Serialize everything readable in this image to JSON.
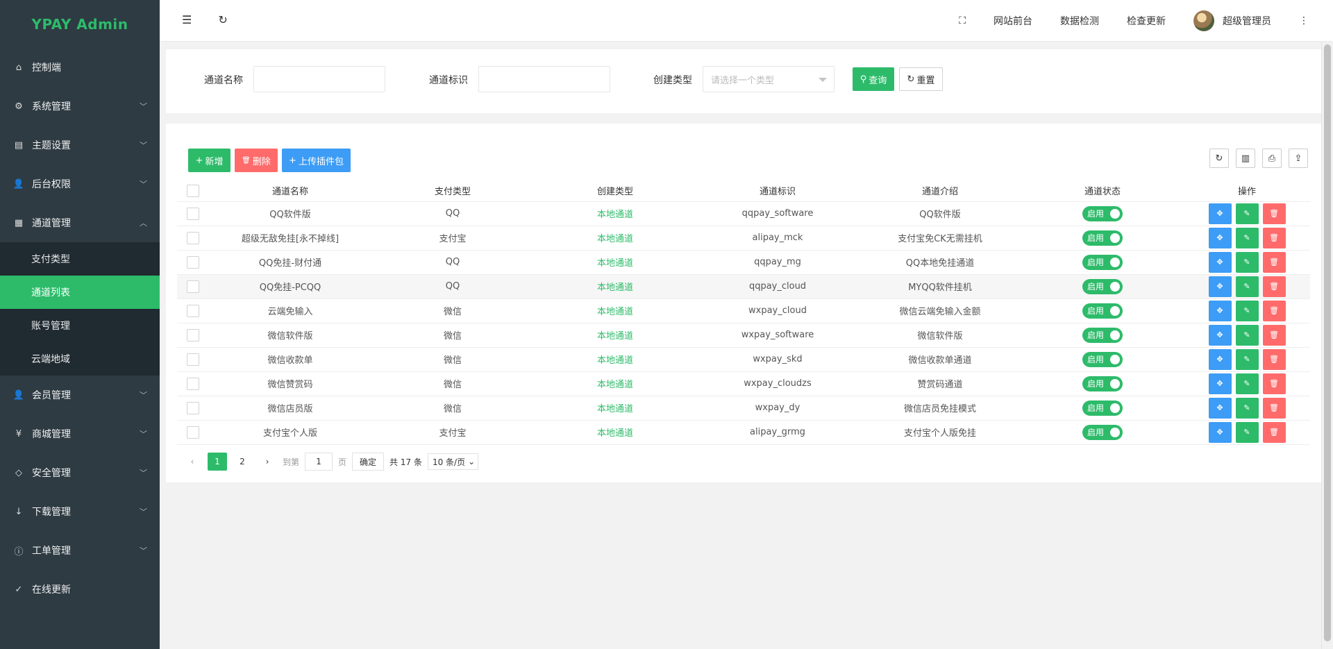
{
  "app": {
    "title": "YPAY Admin"
  },
  "sidebar": {
    "items": [
      {
        "label": "控制端",
        "icon": "home-icon",
        "glyph": "⌂"
      },
      {
        "label": "系统管理",
        "icon": "gear-icon",
        "glyph": "⚙"
      },
      {
        "label": "主题设置",
        "icon": "layout-icon",
        "glyph": "▤"
      },
      {
        "label": "后台权限",
        "icon": "user-icon",
        "glyph": "👤"
      },
      {
        "label": "通道管理",
        "icon": "apps-icon",
        "glyph": "▦"
      }
    ],
    "sub_items": [
      {
        "label": "支付类型"
      },
      {
        "label": "通道列表"
      },
      {
        "label": "账号管理"
      },
      {
        "label": "云端地域"
      }
    ],
    "items_after": [
      {
        "label": "会员管理",
        "icon": "member-icon",
        "glyph": "👤"
      },
      {
        "label": "商城管理",
        "icon": "yen-icon",
        "glyph": "¥"
      },
      {
        "label": "安全管理",
        "icon": "diamond-icon",
        "glyph": "◇"
      },
      {
        "label": "下载管理",
        "icon": "download-icon",
        "glyph": "↓"
      },
      {
        "label": "工单管理",
        "icon": "info-icon",
        "glyph": "ⓘ"
      },
      {
        "label": "在线更新",
        "icon": "shield-check-icon",
        "glyph": "✓"
      }
    ]
  },
  "topbar": {
    "links": [
      "网站前台",
      "数据检测",
      "检查更新"
    ],
    "user": "超级管理员"
  },
  "search": {
    "name_label": "通道名称",
    "code_label": "通道标识",
    "type_label": "创建类型",
    "type_placeholder": "请选择一个类型",
    "query_label": "查询",
    "reset_label": "重置"
  },
  "toolbar": {
    "add_label": "新增",
    "delete_label": "删除",
    "upload_label": "上传插件包"
  },
  "table": {
    "columns": [
      "通道名称",
      "支付类型",
      "创建类型",
      "通道标识",
      "通道介绍",
      "通道状态",
      "操作"
    ],
    "rows": [
      {
        "name": "QQ软件版",
        "pay": "QQ",
        "type": "本地通道",
        "code": "qqpay_software",
        "desc": "QQ软件版",
        "status": "启用"
      },
      {
        "name": "超级无敌免挂[永不掉线]",
        "pay": "支付宝",
        "type": "本地通道",
        "code": "alipay_mck",
        "desc": "支付宝免CK无需挂机",
        "status": "启用"
      },
      {
        "name": "QQ免挂-财付通",
        "pay": "QQ",
        "type": "本地通道",
        "code": "qqpay_mg",
        "desc": "QQ本地免挂通道",
        "status": "启用"
      },
      {
        "name": "QQ免挂-PCQQ",
        "pay": "QQ",
        "type": "本地通道",
        "code": "qqpay_cloud",
        "desc": "MYQQ软件挂机",
        "status": "启用"
      },
      {
        "name": "云端免输入",
        "pay": "微信",
        "type": "本地通道",
        "code": "wxpay_cloud",
        "desc": "微信云端免输入金额",
        "status": "启用"
      },
      {
        "name": "微信软件版",
        "pay": "微信",
        "type": "本地通道",
        "code": "wxpay_software",
        "desc": "微信软件版",
        "status": "启用"
      },
      {
        "name": "微信收款单",
        "pay": "微信",
        "type": "本地通道",
        "code": "wxpay_skd",
        "desc": "微信收款单通道",
        "status": "启用"
      },
      {
        "name": "微信赞赏码",
        "pay": "微信",
        "type": "本地通道",
        "code": "wxpay_cloudzs",
        "desc": "赞赏码通道",
        "status": "启用"
      },
      {
        "name": "微信店员版",
        "pay": "微信",
        "type": "本地通道",
        "code": "wxpay_dy",
        "desc": "微信店员免挂模式",
        "status": "启用"
      },
      {
        "name": "支付宝个人版",
        "pay": "支付宝",
        "type": "本地通道",
        "code": "alipay_grmg",
        "desc": "支付宝个人版免挂",
        "status": "启用"
      }
    ]
  },
  "pager": {
    "pages": [
      "1",
      "2"
    ],
    "current": "1",
    "goto_label": "到第",
    "goto_value": "1",
    "page_unit": "页",
    "confirm_label": "确定",
    "total": "共 17 条",
    "per_page": "10 条/页"
  }
}
